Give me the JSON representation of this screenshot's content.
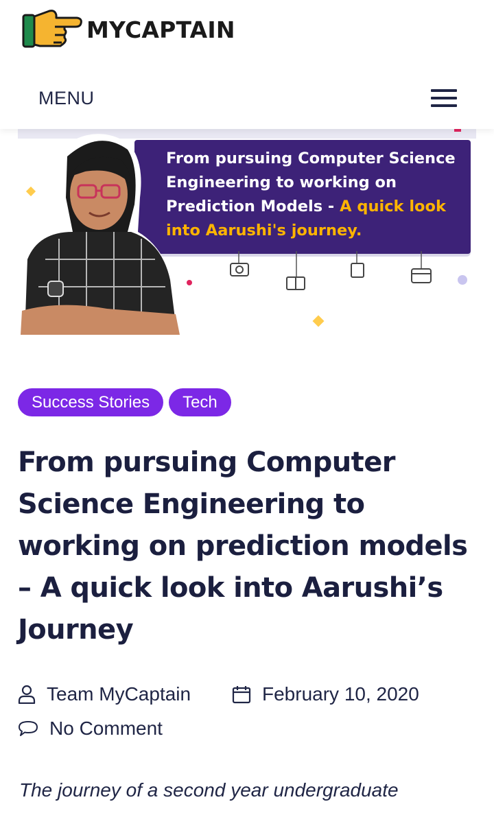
{
  "header": {
    "logo_text": "MYCAPTAIN",
    "menu_label": "MENU"
  },
  "hero": {
    "text_white": "From pursuing Computer Science Engineering to working on Prediction Models - ",
    "text_highlight": "A quick look into Aarushi's journey.",
    "accent_color": "#ffb400",
    "card_color": "#3d2278"
  },
  "tags": [
    "Success Stories",
    "Tech"
  ],
  "tag_color": "#7c28e6",
  "article": {
    "title": "From pursuing Computer Science Engineering to working on prediction models – A quick look into Aarushi’s Journey",
    "author": "Team MyCaptain",
    "date": "February 10, 2020",
    "comments": "No Comment",
    "excerpt": "The journey of a second year undergraduate"
  },
  "icons": {
    "author": "user-icon",
    "date": "calendar-icon",
    "comments": "comment-bubble-icon",
    "menu": "hamburger-menu-icon"
  }
}
